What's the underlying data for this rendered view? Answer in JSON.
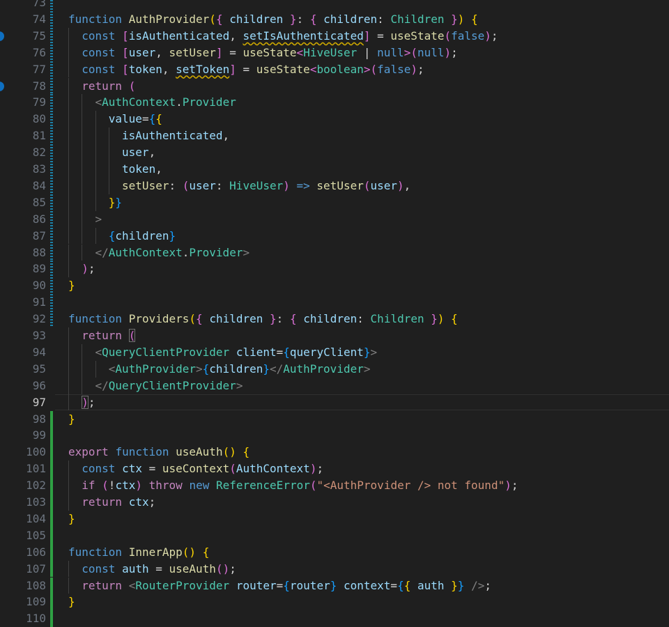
{
  "colors": {
    "background": "#1f1f1f",
    "line_number": "#6e7681",
    "line_number_active": "#cccccc",
    "git_modified": "#1b81a8",
    "git_added": "#2ea043",
    "breakpoint": "#0e6fc1",
    "keyword": "#569cd6",
    "control": "#c586c0",
    "function": "#dcdcaa",
    "variable": "#9cdcfe",
    "type": "#4ec9b0",
    "string": "#ce9178",
    "bracket_1": "#ffd700",
    "bracket_2": "#da70d6",
    "bracket_3": "#179fff",
    "warning_squiggle": "#cca700"
  },
  "editor": {
    "active_line": 97,
    "lines": [
      {
        "n": "73",
        "git": "modified",
        "tokens": []
      },
      {
        "n": "74",
        "git": "modified",
        "tokens": [
          [
            "kw",
            "function"
          ],
          [
            "pun",
            " "
          ],
          [
            "fn",
            "AuthProvider"
          ],
          [
            "b1",
            "("
          ],
          [
            "b2",
            "{"
          ],
          [
            "pun",
            " "
          ],
          [
            "var",
            "children"
          ],
          [
            "pun",
            " "
          ],
          [
            "b2",
            "}"
          ],
          [
            "pun",
            ": "
          ],
          [
            "b2",
            "{"
          ],
          [
            "pun",
            " "
          ],
          [
            "var",
            "children"
          ],
          [
            "pun",
            ": "
          ],
          [
            "type",
            "Children"
          ],
          [
            "pun",
            " "
          ],
          [
            "b2",
            "}"
          ],
          [
            "b1",
            ")"
          ],
          [
            "pun",
            " "
          ],
          [
            "b1",
            "{"
          ]
        ]
      },
      {
        "n": "75",
        "git": "modified",
        "tokens": [
          [
            "kw",
            "const"
          ],
          [
            "pun",
            " "
          ],
          [
            "b2",
            "["
          ],
          [
            "var",
            "isAuthenticated"
          ],
          [
            "pun",
            ", "
          ],
          [
            "warn",
            "setIsAuthenticated"
          ],
          [
            "b2",
            "]"
          ],
          [
            "pun",
            " = "
          ],
          [
            "fn",
            "useState"
          ],
          [
            "b2",
            "("
          ],
          [
            "kw",
            "false"
          ],
          [
            "b2",
            ")"
          ],
          [
            "pun",
            ";"
          ]
        ]
      },
      {
        "n": "76",
        "git": "modified",
        "tokens": [
          [
            "kw",
            "const"
          ],
          [
            "pun",
            " "
          ],
          [
            "b2",
            "["
          ],
          [
            "var",
            "user"
          ],
          [
            "pun",
            ", "
          ],
          [
            "fn",
            "setUser"
          ],
          [
            "b2",
            "]"
          ],
          [
            "pun",
            " = "
          ],
          [
            "fn",
            "useState"
          ],
          [
            "b2",
            "<"
          ],
          [
            "type",
            "HiveUser"
          ],
          [
            "pun",
            " | "
          ],
          [
            "kw",
            "null"
          ],
          [
            "b2",
            ">"
          ],
          [
            "b2",
            "("
          ],
          [
            "kw",
            "null"
          ],
          [
            "b2",
            ")"
          ],
          [
            "pun",
            ";"
          ]
        ]
      },
      {
        "n": "77",
        "git": "modified",
        "tokens": [
          [
            "kw",
            "const"
          ],
          [
            "pun",
            " "
          ],
          [
            "b2",
            "["
          ],
          [
            "var",
            "token"
          ],
          [
            "pun",
            ", "
          ],
          [
            "warn",
            "setToken"
          ],
          [
            "b2",
            "]"
          ],
          [
            "pun",
            " = "
          ],
          [
            "fn",
            "useState"
          ],
          [
            "b2",
            "<"
          ],
          [
            "type",
            "boolean"
          ],
          [
            "b2",
            ">"
          ],
          [
            "b2",
            "("
          ],
          [
            "kw",
            "false"
          ],
          [
            "b2",
            ")"
          ],
          [
            "pun",
            ";"
          ]
        ]
      },
      {
        "n": "78",
        "git": "modified",
        "tokens": [
          [
            "ctl",
            "return"
          ],
          [
            "pun",
            " "
          ],
          [
            "b2",
            "("
          ]
        ]
      },
      {
        "n": "79",
        "git": "modified",
        "tokens": [
          [
            "tag",
            "<"
          ],
          [
            "type",
            "AuthContext"
          ],
          [
            "pun",
            "."
          ],
          [
            "type",
            "Provider"
          ]
        ]
      },
      {
        "n": "80",
        "git": "modified",
        "tokens": [
          [
            "var",
            "value"
          ],
          [
            "pun",
            "="
          ],
          [
            "b3",
            "{"
          ],
          [
            "b1",
            "{"
          ]
        ]
      },
      {
        "n": "81",
        "git": "modified",
        "tokens": [
          [
            "var",
            "isAuthenticated"
          ],
          [
            "pun",
            ","
          ]
        ]
      },
      {
        "n": "82",
        "git": "modified",
        "tokens": [
          [
            "var",
            "user"
          ],
          [
            "pun",
            ","
          ]
        ]
      },
      {
        "n": "83",
        "git": "modified",
        "tokens": [
          [
            "var",
            "token"
          ],
          [
            "pun",
            ","
          ]
        ]
      },
      {
        "n": "84",
        "git": "modified",
        "tokens": [
          [
            "fn",
            "setUser"
          ],
          [
            "pun",
            ": "
          ],
          [
            "b2",
            "("
          ],
          [
            "var",
            "user"
          ],
          [
            "pun",
            ": "
          ],
          [
            "type",
            "HiveUser"
          ],
          [
            "b2",
            ")"
          ],
          [
            "pun",
            " "
          ],
          [
            "kw",
            "=>"
          ],
          [
            "pun",
            " "
          ],
          [
            "fn",
            "setUser"
          ],
          [
            "b2",
            "("
          ],
          [
            "var",
            "user"
          ],
          [
            "b2",
            ")"
          ],
          [
            "pun",
            ","
          ]
        ]
      },
      {
        "n": "85",
        "git": "modified",
        "tokens": [
          [
            "b1",
            "}"
          ],
          [
            "b3",
            "}"
          ]
        ]
      },
      {
        "n": "86",
        "git": "modified",
        "tokens": [
          [
            "tag",
            ">"
          ]
        ]
      },
      {
        "n": "87",
        "git": "modified",
        "tokens": [
          [
            "b3",
            "{"
          ],
          [
            "var",
            "children"
          ],
          [
            "b3",
            "}"
          ]
        ]
      },
      {
        "n": "88",
        "git": "modified",
        "tokens": [
          [
            "tag",
            "</"
          ],
          [
            "type",
            "AuthContext"
          ],
          [
            "pun",
            "."
          ],
          [
            "type",
            "Provider"
          ],
          [
            "tag",
            ">"
          ]
        ]
      },
      {
        "n": "89",
        "git": "modified",
        "tokens": [
          [
            "b2",
            ")"
          ],
          [
            "pun",
            ";"
          ]
        ]
      },
      {
        "n": "90",
        "git": "modified",
        "tokens": [
          [
            "b1",
            "}"
          ]
        ]
      },
      {
        "n": "91",
        "git": "modified",
        "tokens": []
      },
      {
        "n": "92",
        "git": "modified",
        "tokens": [
          [
            "kw",
            "function"
          ],
          [
            "pun",
            " "
          ],
          [
            "fn",
            "Providers"
          ],
          [
            "b1",
            "("
          ],
          [
            "b2",
            "{"
          ],
          [
            "pun",
            " "
          ],
          [
            "var",
            "children"
          ],
          [
            "pun",
            " "
          ],
          [
            "b2",
            "}"
          ],
          [
            "pun",
            ": "
          ],
          [
            "b2",
            "{"
          ],
          [
            "pun",
            " "
          ],
          [
            "var",
            "children"
          ],
          [
            "pun",
            ": "
          ],
          [
            "type",
            "Children"
          ],
          [
            "pun",
            " "
          ],
          [
            "b2",
            "}"
          ],
          [
            "b1",
            ")"
          ],
          [
            "pun",
            " "
          ],
          [
            "b1",
            "{"
          ]
        ]
      },
      {
        "n": "93",
        "git": "",
        "tokens": [
          [
            "ctl",
            "return"
          ],
          [
            "pun",
            " "
          ],
          [
            "b2hl",
            "("
          ]
        ]
      },
      {
        "n": "94",
        "git": "",
        "tokens": [
          [
            "tag",
            "<"
          ],
          [
            "type",
            "QueryClientProvider"
          ],
          [
            "pun",
            " "
          ],
          [
            "var",
            "client"
          ],
          [
            "pun",
            "="
          ],
          [
            "b3",
            "{"
          ],
          [
            "var",
            "queryClient"
          ],
          [
            "b3",
            "}"
          ],
          [
            "tag",
            ">"
          ]
        ]
      },
      {
        "n": "95",
        "git": "",
        "tokens": [
          [
            "tag",
            "<"
          ],
          [
            "type",
            "AuthProvider"
          ],
          [
            "tag",
            ">"
          ],
          [
            "b3",
            "{"
          ],
          [
            "var",
            "children"
          ],
          [
            "b3",
            "}"
          ],
          [
            "tag",
            "</"
          ],
          [
            "type",
            "AuthProvider"
          ],
          [
            "tag",
            ">"
          ]
        ]
      },
      {
        "n": "96",
        "git": "",
        "tokens": [
          [
            "tag",
            "</"
          ],
          [
            "type",
            "QueryClientProvider"
          ],
          [
            "tag",
            ">"
          ]
        ]
      },
      {
        "n": "97",
        "git": "",
        "tokens": [
          [
            "b2hl",
            ")"
          ],
          [
            "pun",
            ";"
          ]
        ]
      },
      {
        "n": "98",
        "git": "added",
        "tokens": [
          [
            "b1",
            "}"
          ]
        ]
      },
      {
        "n": "99",
        "git": "added",
        "tokens": []
      },
      {
        "n": "100",
        "git": "added",
        "tokens": [
          [
            "ctl",
            "export"
          ],
          [
            "pun",
            " "
          ],
          [
            "kw",
            "function"
          ],
          [
            "pun",
            " "
          ],
          [
            "fn",
            "useAuth"
          ],
          [
            "b1",
            "("
          ],
          [
            "b1",
            ")"
          ],
          [
            "pun",
            " "
          ],
          [
            "b1",
            "{"
          ]
        ]
      },
      {
        "n": "101",
        "git": "added",
        "tokens": [
          [
            "kw",
            "const"
          ],
          [
            "pun",
            " "
          ],
          [
            "var",
            "ctx"
          ],
          [
            "pun",
            " = "
          ],
          [
            "fn",
            "useContext"
          ],
          [
            "b2",
            "("
          ],
          [
            "var",
            "AuthContext"
          ],
          [
            "b2",
            ")"
          ],
          [
            "pun",
            ";"
          ]
        ]
      },
      {
        "n": "102",
        "git": "added",
        "tokens": [
          [
            "ctl",
            "if"
          ],
          [
            "pun",
            " "
          ],
          [
            "b2",
            "("
          ],
          [
            "pun",
            "!"
          ],
          [
            "var",
            "ctx"
          ],
          [
            "b2",
            ")"
          ],
          [
            "pun",
            " "
          ],
          [
            "ctl",
            "throw"
          ],
          [
            "pun",
            " "
          ],
          [
            "kw",
            "new"
          ],
          [
            "pun",
            " "
          ],
          [
            "type",
            "ReferenceError"
          ],
          [
            "b2",
            "("
          ],
          [
            "str",
            "\"<AuthProvider /> not found\""
          ],
          [
            "b2",
            ")"
          ],
          [
            "pun",
            ";"
          ]
        ]
      },
      {
        "n": "103",
        "git": "added",
        "tokens": [
          [
            "ctl",
            "return"
          ],
          [
            "pun",
            " "
          ],
          [
            "var",
            "ctx"
          ],
          [
            "pun",
            ";"
          ]
        ]
      },
      {
        "n": "104",
        "git": "added",
        "tokens": [
          [
            "b1",
            "}"
          ]
        ]
      },
      {
        "n": "105",
        "git": "added",
        "tokens": []
      },
      {
        "n": "106",
        "git": "added",
        "tokens": [
          [
            "kw",
            "function"
          ],
          [
            "pun",
            " "
          ],
          [
            "fn",
            "InnerApp"
          ],
          [
            "b1",
            "("
          ],
          [
            "b1",
            ")"
          ],
          [
            "pun",
            " "
          ],
          [
            "b1",
            "{"
          ]
        ]
      },
      {
        "n": "107",
        "git": "added",
        "tokens": [
          [
            "kw",
            "const"
          ],
          [
            "pun",
            " "
          ],
          [
            "var",
            "auth"
          ],
          [
            "pun",
            " = "
          ],
          [
            "fn",
            "useAuth"
          ],
          [
            "b2",
            "("
          ],
          [
            "b2",
            ")"
          ],
          [
            "pun",
            ";"
          ]
        ]
      },
      {
        "n": "108",
        "git": "added",
        "tokens": [
          [
            "ctl",
            "return"
          ],
          [
            "pun",
            " "
          ],
          [
            "tag",
            "<"
          ],
          [
            "type",
            "RouterProvider"
          ],
          [
            "pun",
            " "
          ],
          [
            "var",
            "router"
          ],
          [
            "pun",
            "="
          ],
          [
            "b3",
            "{"
          ],
          [
            "var",
            "router"
          ],
          [
            "b3",
            "}"
          ],
          [
            "pun",
            " "
          ],
          [
            "var",
            "context"
          ],
          [
            "pun",
            "="
          ],
          [
            "b3",
            "{"
          ],
          [
            "b1",
            "{"
          ],
          [
            "pun",
            " "
          ],
          [
            "var",
            "auth"
          ],
          [
            "pun",
            " "
          ],
          [
            "b1",
            "}"
          ],
          [
            "b3",
            "}"
          ],
          [
            "pun",
            " "
          ],
          [
            "tag",
            "/>"
          ],
          [
            "pun",
            ";"
          ]
        ]
      },
      {
        "n": "109",
        "git": "added",
        "tokens": [
          [
            "b1",
            "}"
          ]
        ]
      },
      {
        "n": "110",
        "git": "added",
        "tokens": []
      }
    ]
  }
}
